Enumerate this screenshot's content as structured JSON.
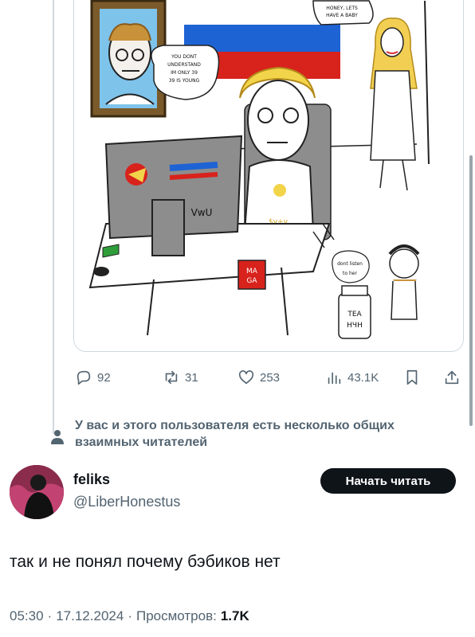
{
  "image": {
    "speech_bubble_wife": "HONEY, LETS HAVE A BABY",
    "speech_bubble_portrait": "YOU DONT UNDERSTAND IM ONLY 39 39 IS YOUNG",
    "speech_bubble_small": "dont listen to her",
    "mug_text": "MA GA",
    "jar_text": "TEA НЧН",
    "shirt_text": "$v+v",
    "monitor_text": "VwU"
  },
  "actions": {
    "replies": "92",
    "reposts": "31",
    "likes": "253",
    "views": "43.1K"
  },
  "context": {
    "text": "У вас и этого пользователя есть несколько общих взаимных читателей"
  },
  "author": {
    "display_name": "feliks",
    "handle": "@LiberHonestus",
    "follow_label": "Начать читать"
  },
  "tweet": {
    "text": "так и не понял почему бэбиков нет"
  },
  "meta": {
    "time": "05:30",
    "sep1": "·",
    "date": "17.12.2024",
    "sep2": "·",
    "views_label": "Просмотров:",
    "views_count": "1.7K"
  },
  "colors": {
    "text_primary": "#0f1419",
    "text_secondary": "#536471",
    "border": "#cfd9de"
  }
}
